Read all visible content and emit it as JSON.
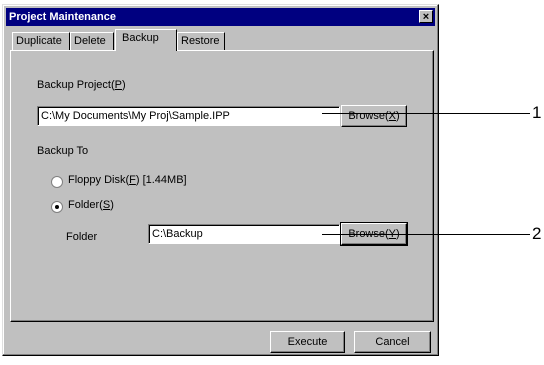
{
  "window": {
    "title": "Project Maintenance",
    "close_glyph": "×"
  },
  "tabs": [
    {
      "label": "Duplicate"
    },
    {
      "label": "Delete"
    },
    {
      "label": "Backup"
    },
    {
      "label": "Restore"
    }
  ],
  "backup_project": {
    "label": "Backup Project(",
    "mnemonic": "P",
    "label_end": ")",
    "value": "C:\\My Documents\\My Proj\\Sample.IPP",
    "browse": {
      "label": "Browse(",
      "mnemonic": "X",
      "label_end": ")"
    }
  },
  "backup_to": {
    "label": "Backup To",
    "floppy": {
      "label": "Floppy Disk(",
      "mnemonic": "F",
      "label_end": ") [1.44MB]",
      "checked": false
    },
    "folder_option": {
      "label": "Folder(",
      "mnemonic": "S",
      "label_end": ")",
      "checked": true
    },
    "folder_label": "Folder",
    "folder_value": "C:\\Backup",
    "browse": {
      "label": "Browse(",
      "mnemonic": "Y",
      "label_end": ")"
    }
  },
  "buttons": {
    "execute": "Execute",
    "cancel": "Cancel"
  },
  "callouts": [
    "1",
    "2"
  ]
}
